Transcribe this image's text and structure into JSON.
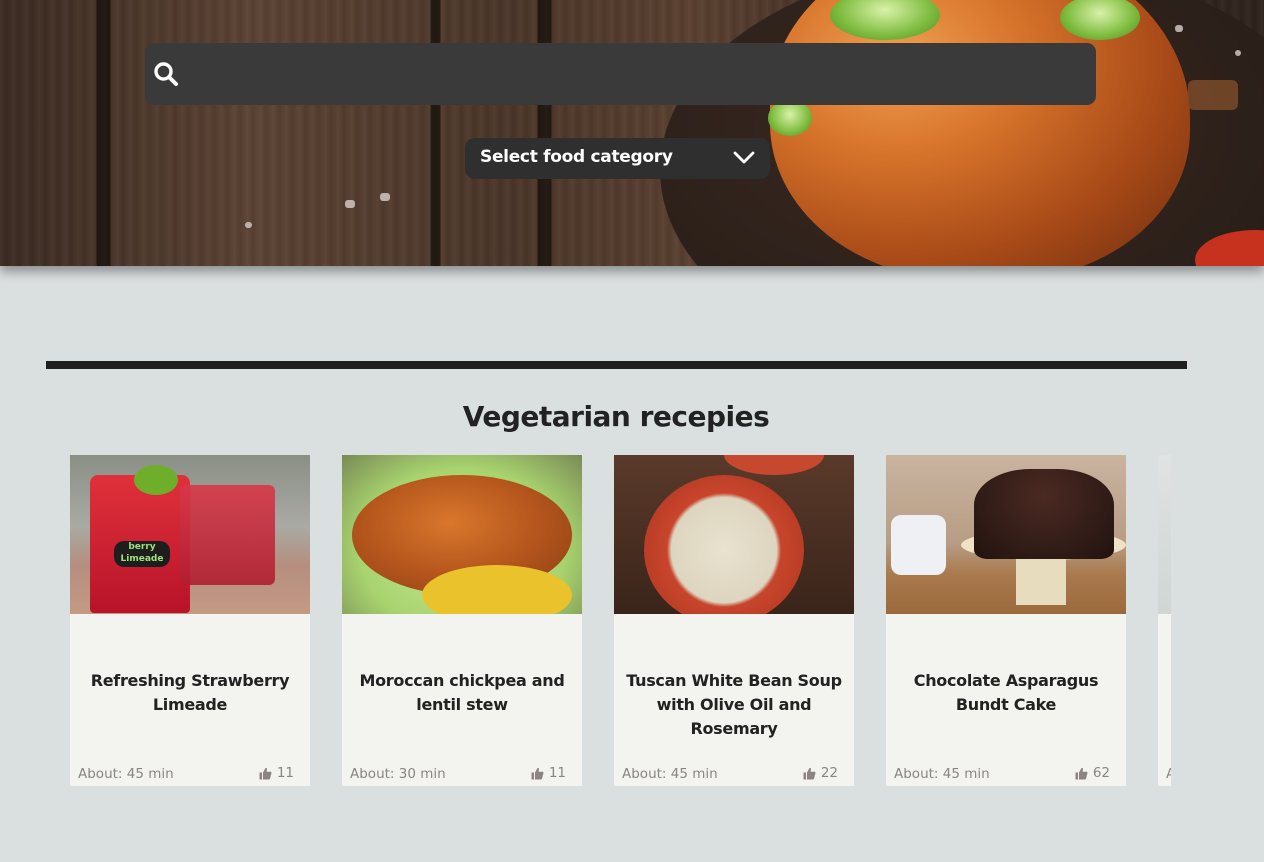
{
  "search": {
    "placeholder": "",
    "value": ""
  },
  "category_select": {
    "label": "Select food category"
  },
  "section": {
    "title": "Vegetarian recepies"
  },
  "recipes": [
    {
      "name": "Refreshing Strawberry Limeade",
      "time": "About: 45 min",
      "likes": "11"
    },
    {
      "name": "Moroccan chickpea and lentil stew",
      "time": "About: 30 min",
      "likes": "11"
    },
    {
      "name": "Tuscan White Bean Soup with Olive Oil and Rosemary",
      "time": "About: 45 min",
      "likes": "22"
    },
    {
      "name": "Chocolate Asparagus Bundt Cake",
      "time": "About: 45 min",
      "likes": "62"
    },
    {
      "name": "",
      "time": "A",
      "likes": ""
    }
  ],
  "drink_sign_text": "berry Limeade",
  "icons": {
    "search": "search-icon",
    "dropdown": "chevron-down-icon",
    "like": "thumbs-up-icon"
  },
  "colors": {
    "page_bg": "#dadfe0",
    "search_bg": "#3a3a3a",
    "select_bg": "#2f2f2f",
    "card_bg": "#f3f3ef",
    "muted_text": "#8a8583"
  }
}
